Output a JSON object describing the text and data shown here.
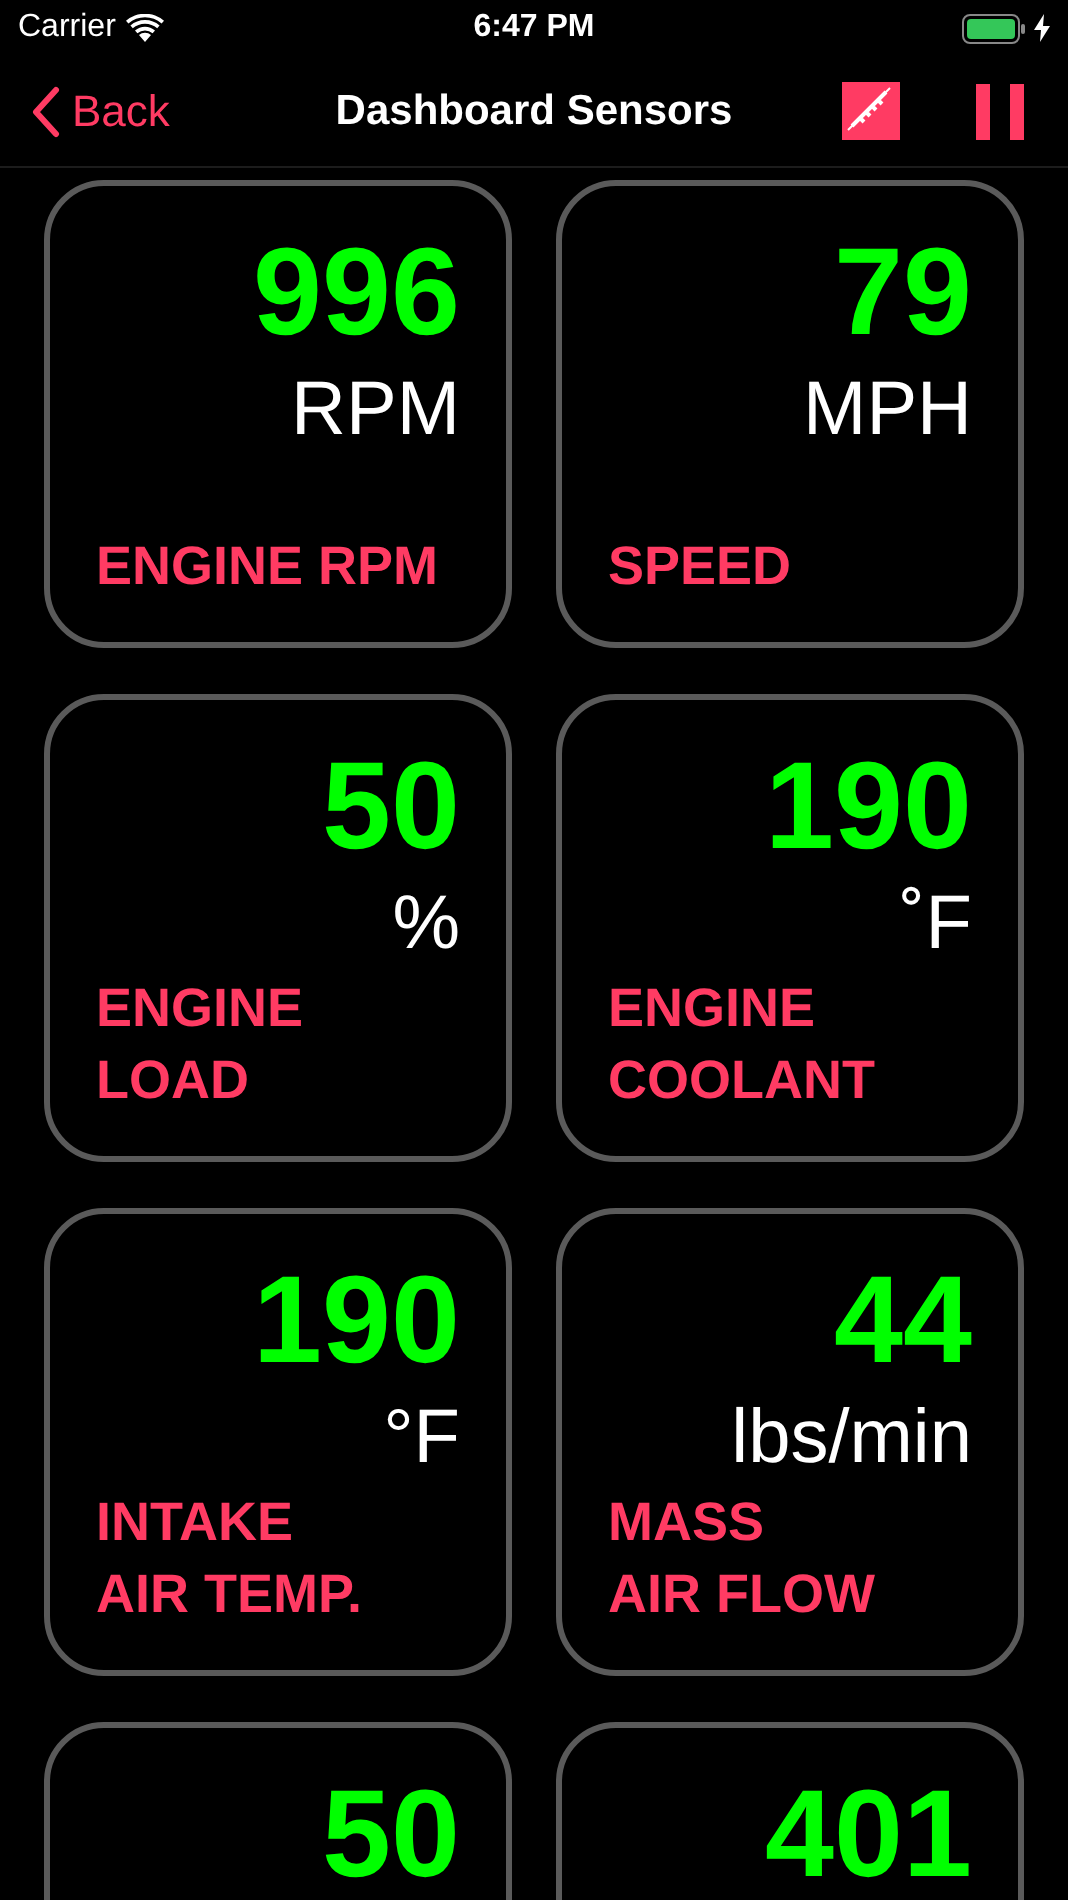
{
  "status_bar": {
    "carrier": "Carrier",
    "time": "6:47 PM"
  },
  "nav": {
    "back": "Back",
    "title": "Dashboard Sensors"
  },
  "sensors": [
    {
      "value": "996",
      "unit": "RPM",
      "label": [
        "ENGINE RPM"
      ]
    },
    {
      "value": "79",
      "unit": "MPH",
      "label": [
        "SPEED"
      ]
    },
    {
      "value": "50",
      "unit": "%",
      "label": [
        "ENGINE",
        "LOAD"
      ]
    },
    {
      "value": "190",
      "unit": "˚F",
      "label": [
        "ENGINE",
        "COOLANT"
      ]
    },
    {
      "value": "190",
      "unit": "°F",
      "label": [
        "INTAKE",
        "AIR TEMP."
      ]
    },
    {
      "value": "44",
      "unit": "lbs/min",
      "label": [
        "MASS",
        "AIR FLOW"
      ]
    },
    {
      "value": "50"
    },
    {
      "value": "401"
    }
  ]
}
